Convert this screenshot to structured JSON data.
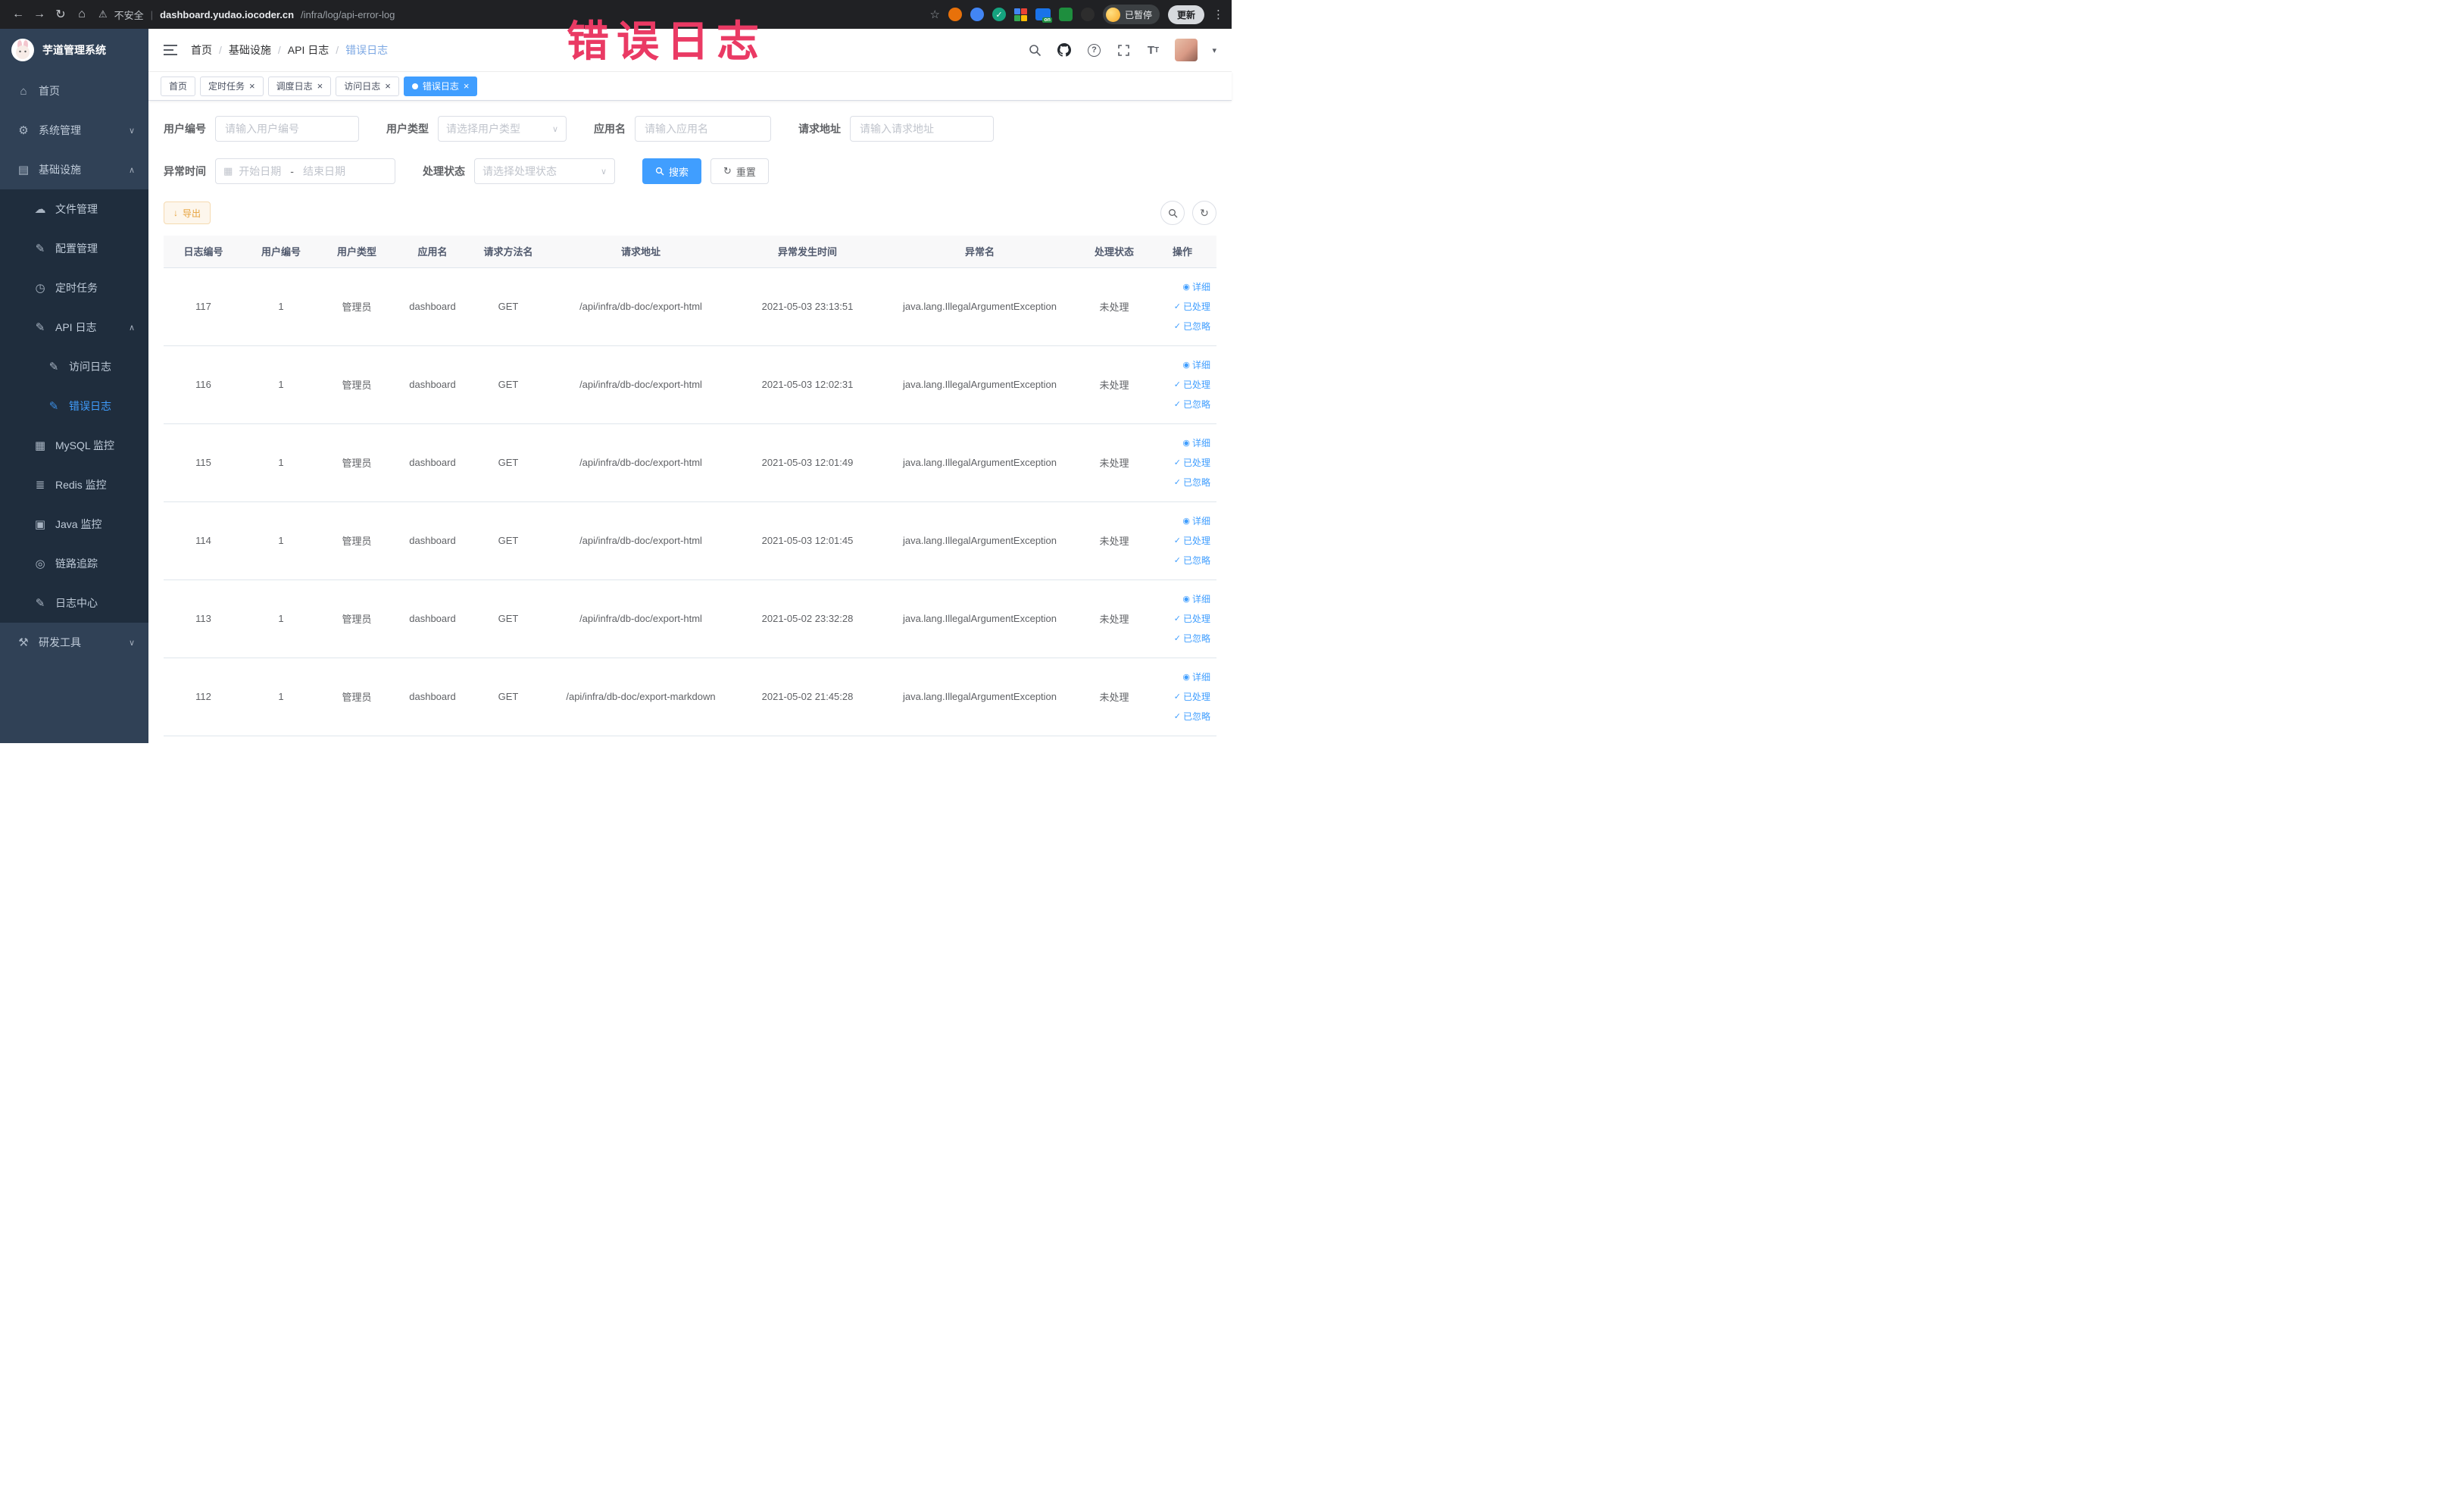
{
  "colors": {
    "accent": "#409eff",
    "warning": "#e6a23c",
    "annotation": "#ea3a64",
    "sidebar-bg": "#304156",
    "submenu-bg": "#1f2d3d",
    "chrome-bg": "#202124"
  },
  "browser": {
    "security_label": "不安全",
    "url_domain": "dashboard.yudao.iocoder.cn",
    "url_path": "/infra/log/api-error-log",
    "profile_label": "已暂停",
    "update_label": "更新"
  },
  "annotation": {
    "text": "错误日志"
  },
  "icons": {
    "back": "←",
    "forward": "→",
    "reload": "↻",
    "home": "⌂",
    "warning": "⚠",
    "star": "☆",
    "kebab": "⋮",
    "dashboard": "⌂",
    "gear": "⚙",
    "infra": "▤",
    "file": "☁",
    "config": "✎",
    "job": "◷",
    "apilog": "✎",
    "accesslog": "✎",
    "errorlog": "✎",
    "mysql": "▦",
    "redis": "≣",
    "java": "▣",
    "trace": "◎",
    "logcenter": "✎",
    "devtools": "⚒",
    "chevron_down": "∨",
    "chevron_up": "∧",
    "calendar": "▦",
    "caret_down": "▾",
    "close": "×",
    "reset": "↻",
    "refresh": "↻",
    "download": "↓",
    "detail": "◉",
    "check": "✓"
  },
  "sidebar": {
    "title": "芋道管理系统",
    "items": [
      {
        "label": "首页"
      },
      {
        "label": "系统管理"
      },
      {
        "label": "基础设施"
      },
      {
        "label": "文件管理"
      },
      {
        "label": "配置管理"
      },
      {
        "label": "定时任务"
      },
      {
        "label": "API 日志"
      },
      {
        "label": "访问日志"
      },
      {
        "label": "错误日志"
      },
      {
        "label": "MySQL 监控"
      },
      {
        "label": "Redis 监控"
      },
      {
        "label": "Java 监控"
      },
      {
        "label": "链路追踪"
      },
      {
        "label": "日志中心"
      },
      {
        "label": "研发工具"
      }
    ]
  },
  "header": {
    "breadcrumb": [
      "首页",
      "基础设施",
      "API 日志",
      "错误日志"
    ],
    "separator": "/"
  },
  "tabs": [
    {
      "label": "首页"
    },
    {
      "label": "定时任务"
    },
    {
      "label": "调度日志"
    },
    {
      "label": "访问日志"
    },
    {
      "label": "错误日志"
    }
  ],
  "filters": {
    "user_id": {
      "label": "用户编号",
      "placeholder": "请输入用户编号",
      "value": ""
    },
    "user_type": {
      "label": "用户类型",
      "placeholder": "请选择用户类型"
    },
    "app_name": {
      "label": "应用名",
      "placeholder": "请输入应用名",
      "value": ""
    },
    "request_url": {
      "label": "请求地址",
      "placeholder": "请输入请求地址",
      "value": ""
    },
    "exception_time": {
      "label": "异常时间",
      "start_placeholder": "开始日期",
      "separator": "-",
      "end_placeholder": "结束日期"
    },
    "process_status": {
      "label": "处理状态",
      "placeholder": "请选择处理状态"
    },
    "search_label": "搜索",
    "reset_label": "重置"
  },
  "toolbar": {
    "export_label": "导出"
  },
  "table": {
    "columns": [
      "日志编号",
      "用户编号",
      "用户类型",
      "应用名",
      "请求方法名",
      "请求地址",
      "异常发生时间",
      "异常名",
      "处理状态",
      "操作"
    ],
    "actions": [
      "详细",
      "已处理",
      "已忽略"
    ],
    "rows": [
      {
        "id": "117",
        "user_id": "1",
        "user_type": "管理员",
        "app": "dashboard",
        "method": "GET",
        "url": "/api/infra/db-doc/export-html",
        "time": "2021-05-03 23:13:51",
        "exception": "java.lang.IllegalArgumentException",
        "status": "未处理"
      },
      {
        "id": "116",
        "user_id": "1",
        "user_type": "管理员",
        "app": "dashboard",
        "method": "GET",
        "url": "/api/infra/db-doc/export-html",
        "time": "2021-05-03 12:02:31",
        "exception": "java.lang.IllegalArgumentException",
        "status": "未处理"
      },
      {
        "id": "115",
        "user_id": "1",
        "user_type": "管理员",
        "app": "dashboard",
        "method": "GET",
        "url": "/api/infra/db-doc/export-html",
        "time": "2021-05-03 12:01:49",
        "exception": "java.lang.IllegalArgumentException",
        "status": "未处理"
      },
      {
        "id": "114",
        "user_id": "1",
        "user_type": "管理员",
        "app": "dashboard",
        "method": "GET",
        "url": "/api/infra/db-doc/export-html",
        "time": "2021-05-03 12:01:45",
        "exception": "java.lang.IllegalArgumentException",
        "status": "未处理"
      },
      {
        "id": "113",
        "user_id": "1",
        "user_type": "管理员",
        "app": "dashboard",
        "method": "GET",
        "url": "/api/infra/db-doc/export-html",
        "time": "2021-05-02 23:32:28",
        "exception": "java.lang.IllegalArgumentException",
        "status": "未处理"
      },
      {
        "id": "112",
        "user_id": "1",
        "user_type": "管理员",
        "app": "dashboard",
        "method": "GET",
        "url": "/api/infra/db-doc/export-markdown",
        "time": "2021-05-02 21:45:28",
        "exception": "java.lang.IllegalArgumentException",
        "status": "未处理"
      }
    ]
  }
}
